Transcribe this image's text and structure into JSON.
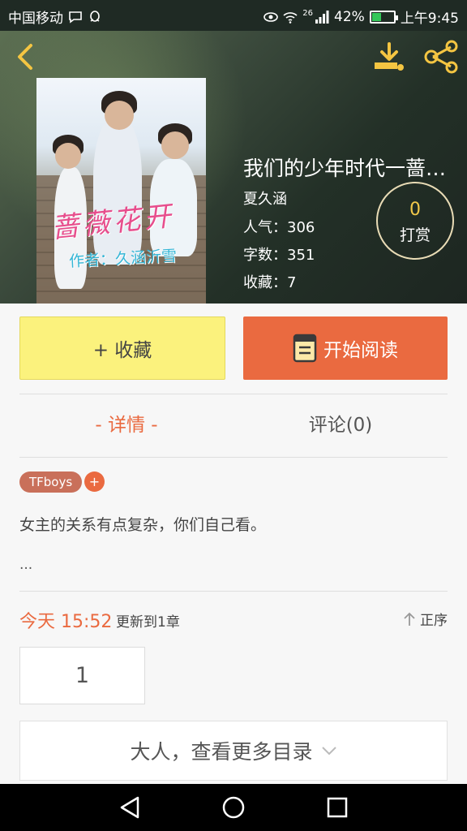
{
  "status_bar": {
    "carrier": "中国移动",
    "network_label": "26",
    "battery": "42%",
    "time": "上午9:45",
    "icons": [
      "message-icon",
      "qq-icon",
      "eye-icon",
      "wifi-icon",
      "signal-icon",
      "battery-icon"
    ],
    "battery_level": 0.42,
    "battery_color": "#34c759"
  },
  "header": {
    "back_icon": "back-arrow-icon",
    "download_icon": "download-icon",
    "share_icon": "share-icon",
    "accent": "#f1c84a"
  },
  "book": {
    "cover_title": "蔷薇花开",
    "cover_author": "作者：久涵沂雪",
    "title": "我们的少年时代一蔷…",
    "author": "夏久涵",
    "popularity_label": "人气",
    "popularity_value": "306",
    "words_label": "字数",
    "words_value": "351",
    "favorites_label": "收藏",
    "favorites_value": "7",
    "tip_count": "0",
    "tip_label": "打赏"
  },
  "actions": {
    "favorite_label": "+ 收藏",
    "read_label": "开始阅读",
    "read_icon": "book-icon"
  },
  "tabs": {
    "detail": "- 详情 -",
    "comments": "评论(0)"
  },
  "tags": {
    "items": [
      "TFboys"
    ],
    "add_label": "+"
  },
  "description": {
    "text": "女主的关系有点复杂，你们自己看。",
    "more": "..."
  },
  "update": {
    "time": "今天 15:52",
    "text": "更新到1章",
    "order_label": "正序",
    "order_icon": "arrow-up-icon"
  },
  "chapters": {
    "first": "1",
    "more_label": "大人，查看更多目录"
  },
  "colors": {
    "accent_orange": "#ea6a40",
    "favorite_yellow": "#fbf27d",
    "tag_brown": "#c9705a"
  },
  "nav": {
    "icons": [
      "nav-back-icon",
      "nav-home-icon",
      "nav-recents-icon"
    ]
  }
}
